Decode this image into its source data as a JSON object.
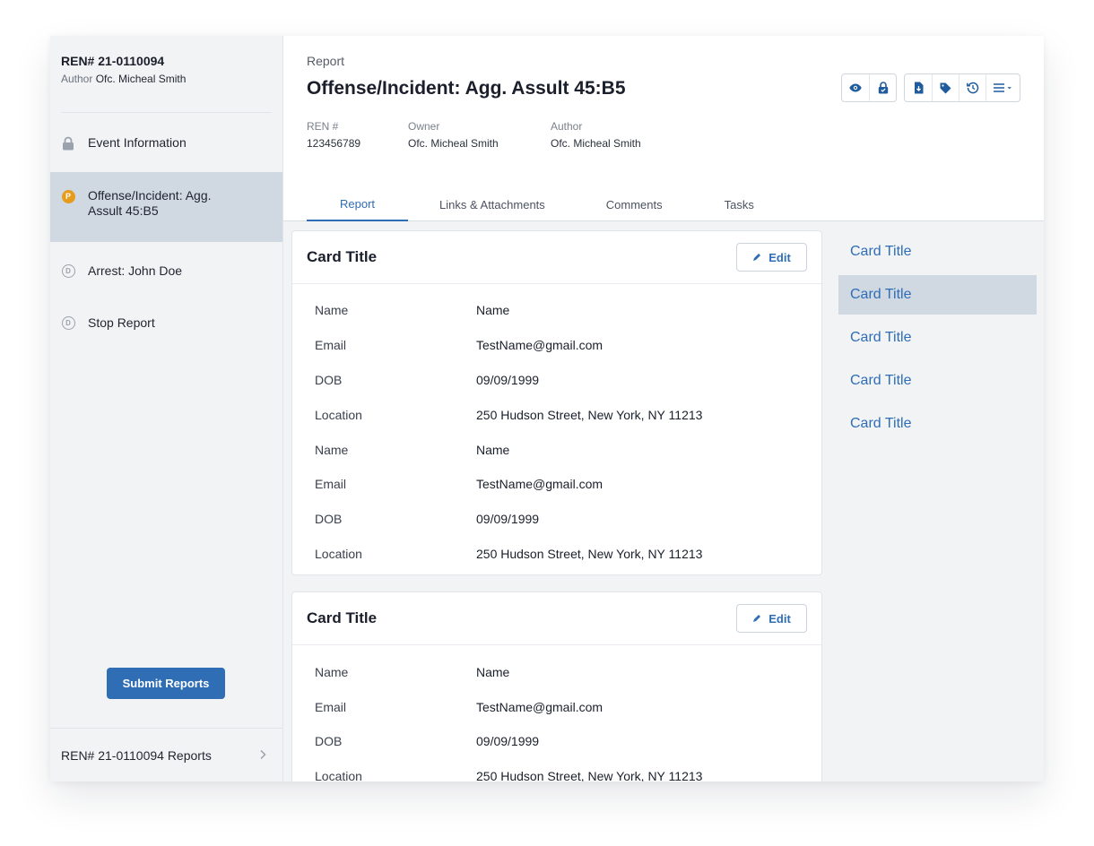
{
  "sidebar": {
    "ren": "REN# 21-0110094",
    "author_label": "Author",
    "author_name": "Ofc. Micheal Smith",
    "items": [
      {
        "label": "Event Information"
      },
      {
        "label": "Offense/Incident: Agg. Assult 45:B5",
        "badge": "P"
      },
      {
        "label": "Arrest: John Doe",
        "badge": "D"
      },
      {
        "label": "Stop Report",
        "badge": "D"
      }
    ],
    "submit_label": "Submit Reports",
    "footer_label": "REN# 21-0110094 Reports"
  },
  "header": {
    "kicker": "Report",
    "title": "Offense/Incident: Agg. Assult 45:B5",
    "meta": [
      {
        "key": "REN #",
        "value": "123456789"
      },
      {
        "key": "Owner",
        "value": "Ofc. Micheal Smith"
      },
      {
        "key": "Author",
        "value": "Ofc. Micheal Smith"
      }
    ],
    "toolbar_icons": [
      "eye-icon",
      "lock-icon",
      "file-icon",
      "tag-icon",
      "history-icon",
      "menu-icon"
    ]
  },
  "tabs": [
    {
      "label": "Report"
    },
    {
      "label": "Links & Attachments"
    },
    {
      "label": "Comments"
    },
    {
      "label": "Tasks"
    }
  ],
  "cards": [
    {
      "title": "Card Title",
      "edit_label": "Edit",
      "rows": [
        {
          "k": "Name",
          "v": "Name"
        },
        {
          "k": "Email",
          "v": "TestName@gmail.com"
        },
        {
          "k": "DOB",
          "v": "09/09/1999"
        },
        {
          "k": "Location",
          "v": "250 Hudson Street, New York, NY 11213"
        },
        {
          "k": "Name",
          "v": "Name"
        },
        {
          "k": "Email",
          "v": "TestName@gmail.com"
        },
        {
          "k": "DOB",
          "v": "09/09/1999"
        },
        {
          "k": "Location",
          "v": "250 Hudson Street, New York, NY 11213"
        }
      ]
    },
    {
      "title": "Card Title",
      "edit_label": "Edit",
      "rows": [
        {
          "k": "Name",
          "v": "Name"
        },
        {
          "k": "Email",
          "v": "TestName@gmail.com"
        },
        {
          "k": "DOB",
          "v": "09/09/1999"
        },
        {
          "k": "Location",
          "v": "250 Hudson Street, New York, NY 11213"
        }
      ]
    }
  ],
  "toc": [
    "Card Title",
    "Card Title",
    "Card Title",
    "Card Title",
    "Card Title"
  ],
  "colors": {
    "accent": "#2f6db5",
    "active_bg": "#d0d8e2",
    "badge_p": "#e69b1b"
  }
}
